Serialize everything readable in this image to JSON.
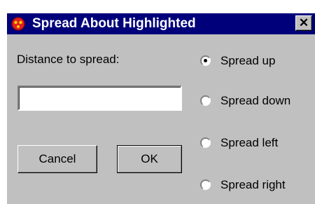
{
  "window": {
    "title": "Spread About Highlighted",
    "close_glyph": "✕",
    "app_icon": "app-icon",
    "title_bar_color": "#00007a",
    "body_color": "#c0c0c0"
  },
  "form": {
    "distance_label": "Distance to spread:",
    "distance_value": "",
    "cancel_label": "Cancel",
    "ok_label": "OK"
  },
  "options": [
    {
      "label": "Spread up",
      "selected": true
    },
    {
      "label": "Spread down",
      "selected": false
    },
    {
      "label": "Spread left",
      "selected": false
    },
    {
      "label": "Spread right",
      "selected": false
    }
  ]
}
